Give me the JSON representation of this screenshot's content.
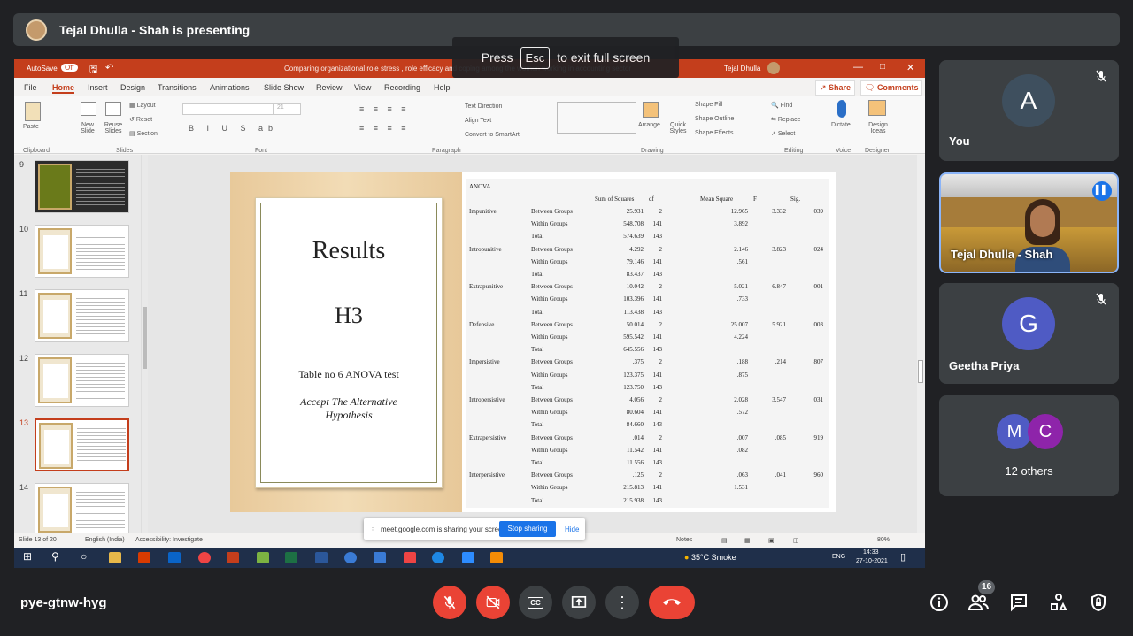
{
  "presenter": {
    "text": "Tejal Dhulla - Shah is presenting"
  },
  "fullscreen": {
    "press": "Press",
    "key": "Esc",
    "rest": "to exit full screen"
  },
  "ppt": {
    "titlebar": {
      "autosave": "AutoSave",
      "off": "Off",
      "doc": "Comparing organizational role stress , role efficacy and coping among the women working in accounting sector",
      "user": "Tejal Dhulla"
    },
    "menu": [
      "File",
      "Home",
      "Insert",
      "Design",
      "Transitions",
      "Animations",
      "Slide Show",
      "Review",
      "View",
      "Recording",
      "Help"
    ],
    "share": "Share",
    "comments": "Comments",
    "ribbon": {
      "paste": "Paste",
      "new_slide": "New Slide",
      "reuse": "Reuse Slides",
      "layout": "Layout",
      "reset": "Reset",
      "section": "Section",
      "text_direction": "Text Direction",
      "align_text": "Align Text",
      "convert": "Convert to SmartArt",
      "arrange": "Arrange",
      "quick_styles": "Quick Styles",
      "shape_fill": "Shape Fill",
      "shape_outline": "Shape Outline",
      "shape_effects": "Shape Effects",
      "find": "Find",
      "replace": "Replace",
      "select": "Select",
      "dictate": "Dictate",
      "design_ideas": "Design Ideas",
      "font_size": "21",
      "groups": [
        "Clipboard",
        "Slides",
        "Font",
        "Paragraph",
        "Drawing",
        "Editing",
        "Voice",
        "Designer"
      ]
    },
    "thumbs": [
      {
        "n": "9"
      },
      {
        "n": "10"
      },
      {
        "n": "11"
      },
      {
        "n": "12"
      },
      {
        "n": "13"
      },
      {
        "n": "14"
      }
    ],
    "slide": {
      "title": "Results",
      "sub": "H3",
      "table_caption": "Table no 6 ANOVA test",
      "accept": "Accept The Alternative Hypothesis",
      "anova": "ANOVA",
      "headers": [
        "Sum of Squares",
        "df",
        "Mean Square",
        "F",
        "Sig."
      ],
      "rows": [
        [
          "Impunitive",
          "Between Groups",
          "25.931",
          "2",
          "12.965",
          "3.332",
          ".039"
        ],
        [
          "",
          "Within Groups",
          "548.708",
          "141",
          "3.892",
          "",
          ""
        ],
        [
          "",
          "Total",
          "574.639",
          "143",
          "",
          "",
          ""
        ],
        [
          "Intropunitive",
          "Between Groups",
          "4.292",
          "2",
          "2.146",
          "3.823",
          ".024"
        ],
        [
          "",
          "Within Groups",
          "79.146",
          "141",
          ".561",
          "",
          ""
        ],
        [
          "",
          "Total",
          "83.437",
          "143",
          "",
          "",
          ""
        ],
        [
          "Extrapunitive",
          "Between Groups",
          "10.042",
          "2",
          "5.021",
          "6.847",
          ".001"
        ],
        [
          "",
          "Within Groups",
          "103.396",
          "141",
          ".733",
          "",
          ""
        ],
        [
          "",
          "Total",
          "113.438",
          "143",
          "",
          "",
          ""
        ],
        [
          "Defensive",
          "Between Groups",
          "50.014",
          "2",
          "25.007",
          "5.921",
          ".003"
        ],
        [
          "",
          "Within Groups",
          "595.542",
          "141",
          "4.224",
          "",
          ""
        ],
        [
          "",
          "Total",
          "645.556",
          "143",
          "",
          "",
          ""
        ],
        [
          "Impersistive",
          "Between Groups",
          ".375",
          "2",
          ".188",
          ".214",
          ".807"
        ],
        [
          "",
          "Within Groups",
          "123.375",
          "141",
          ".875",
          "",
          ""
        ],
        [
          "",
          "Total",
          "123.750",
          "143",
          "",
          "",
          ""
        ],
        [
          "Intropersistive",
          "Between Groups",
          "4.056",
          "2",
          "2.028",
          "3.547",
          ".031"
        ],
        [
          "",
          "Within Groups",
          "80.604",
          "141",
          ".572",
          "",
          ""
        ],
        [
          "",
          "Total",
          "84.660",
          "143",
          "",
          "",
          ""
        ],
        [
          "Extrapersistive",
          "Between Groups",
          ".014",
          "2",
          ".007",
          ".085",
          ".919"
        ],
        [
          "",
          "Within Groups",
          "11.542",
          "141",
          ".082",
          "",
          ""
        ],
        [
          "",
          "Total",
          "11.556",
          "143",
          "",
          "",
          ""
        ],
        [
          "Interpersistive",
          "Between Groups",
          ".125",
          "2",
          ".063",
          ".041",
          ".960"
        ],
        [
          "",
          "Within Groups",
          "215.813",
          "141",
          "1.531",
          "",
          ""
        ],
        [
          "",
          "Total",
          "215.938",
          "143",
          "",
          "",
          ""
        ]
      ]
    },
    "status": {
      "slide": "Slide 13 of 20",
      "lang": "English (India)",
      "access": "Accessibility: Investigate",
      "notes": "Notes",
      "zoom": "80%"
    },
    "sharebar": {
      "text": "meet.google.com is sharing your screen.",
      "stop": "Stop sharing",
      "hide": "Hide"
    },
    "taskbar": {
      "weather": "35°C  Smoke",
      "lang": "ENG",
      "time": "14:33",
      "date": "27-10-2021"
    }
  },
  "participants": {
    "you": {
      "initial": "A",
      "name": "You"
    },
    "presenter": {
      "name": "Tejal Dhulla - Shah"
    },
    "geetha": {
      "initial": "G",
      "name": "Geetha Priya"
    },
    "others": {
      "m": "M",
      "c": "C",
      "label": "12 others"
    }
  },
  "meeting": {
    "code": "pye-gtnw-hyg",
    "people_count": "16"
  },
  "colors": {
    "accent_red": "#ea4335",
    "ppt_orange": "#c43e1c",
    "blue": "#1a73e8"
  }
}
